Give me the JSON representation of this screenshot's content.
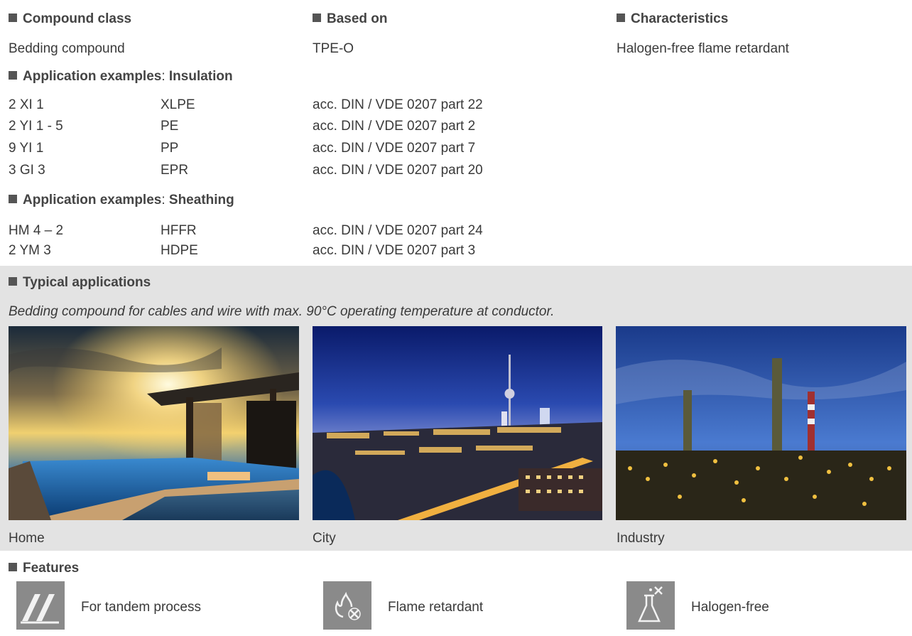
{
  "compound": {
    "class_heading": "Compound class",
    "class_value": "Bedding compound",
    "based_heading": "Based on",
    "based_value": "TPE-O",
    "char_heading": "Characteristics",
    "char_value": "Halogen-free flame retardant"
  },
  "insulation": {
    "heading_bold": "Application examples",
    "heading_sep": ":",
    "heading_tail": "Insulation",
    "rows": [
      {
        "code": "2 XI 1",
        "material": "XLPE",
        "standard": "acc. DIN / VDE 0207 part 22"
      },
      {
        "code": "2 YI 1 - 5",
        "material": "PE",
        "standard": "acc. DIN / VDE 0207 part 2"
      },
      {
        "code": "9 YI 1",
        "material": "PP",
        "standard": "acc. DIN / VDE 0207 part 7"
      },
      {
        "code": "3 GI 3",
        "material": "EPR",
        "standard": "acc. DIN / VDE 0207 part 20"
      }
    ]
  },
  "sheathing": {
    "heading_bold": "Application examples",
    "heading_sep": ":",
    "heading_tail": "Sheathing",
    "rows": [
      {
        "code": "HM 4 – 2",
        "material": "HFFR",
        "standard": "acc. DIN / VDE 0207 part 24"
      },
      {
        "code": "2 YM 3",
        "material": "HDPE",
        "standard": "acc. DIN / VDE 0207 part 3"
      }
    ]
  },
  "typical": {
    "heading": "Typical applications",
    "description": "Bedding compound for cables and wire with max. 90°C operating temperature at conductor.",
    "photos": [
      {
        "caption": "Home"
      },
      {
        "caption": "City"
      },
      {
        "caption": "Industry"
      }
    ]
  },
  "features": {
    "heading": "Features",
    "items": [
      {
        "label": "For tandem process",
        "icon": "tandem-process-icon"
      },
      {
        "label": "Flame retardant",
        "icon": "flame-retardant-icon"
      },
      {
        "label": "Halogen-free",
        "icon": "halogen-free-icon"
      }
    ]
  },
  "colors": {
    "band": "#e3e3e3",
    "icon_bg": "#8a8a8a",
    "bullet": "#555555"
  }
}
